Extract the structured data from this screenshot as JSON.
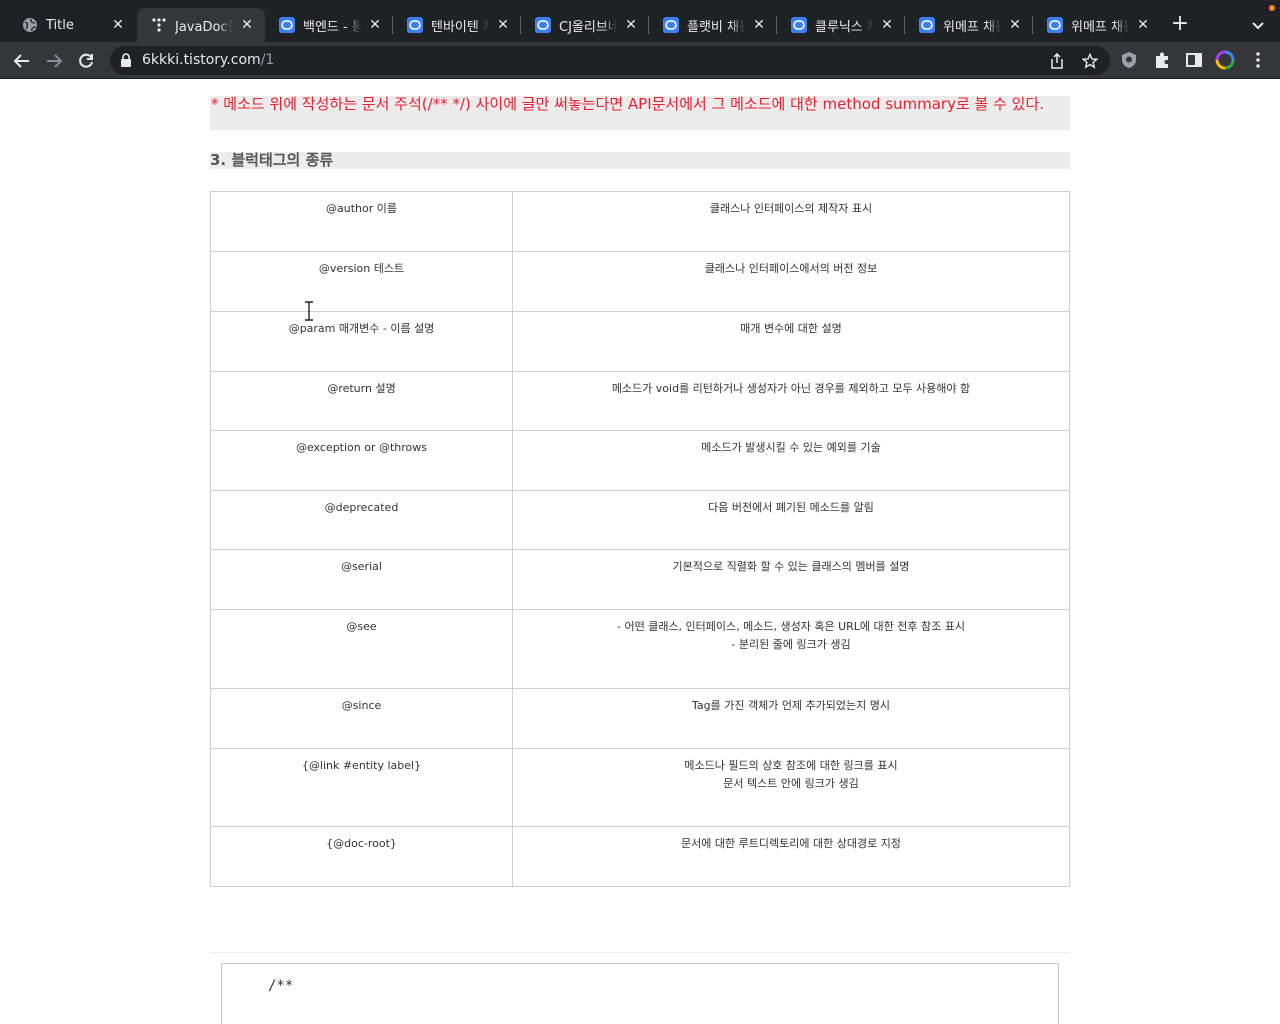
{
  "browser": {
    "tabs": [
      {
        "title": "Title",
        "favicon": "globe-icon",
        "active": false
      },
      {
        "title": "JavaDoc을",
        "favicon": "tistory-icon",
        "active": true
      },
      {
        "title": "백엔드 - 통합",
        "favicon": "chat-app-icon",
        "active": false
      },
      {
        "title": "텐바이텐 채용",
        "favicon": "chat-app-icon",
        "active": false
      },
      {
        "title": "CJ올리브네트",
        "favicon": "chat-app-icon",
        "active": false
      },
      {
        "title": "플랫비 채용 -",
        "favicon": "chat-app-icon",
        "active": false
      },
      {
        "title": "클루닉스 채용",
        "favicon": "chat-app-icon",
        "active": false
      },
      {
        "title": "위메프 채용 -",
        "favicon": "chat-app-icon",
        "active": false
      },
      {
        "title": "위메프 채용 -",
        "favicon": "chat-app-icon",
        "active": false
      }
    ],
    "close_glyph": "✕",
    "new_tab_glyph": "+",
    "url_host": "6kkki.tistory.com",
    "url_path": "/1"
  },
  "article": {
    "note": "* 메소드 위에 작성하는 문서 주석(/** */) 사이에 글만 써놓는다면 API문서에서 그 메소드에 대한 method summary로 볼 수 있다.",
    "heading": "3. 블럭태그의 종류",
    "table": {
      "rows": [
        {
          "tag": "@author 이름",
          "desc": [
            "클래스나 인터페이스의 제작자 표시"
          ]
        },
        {
          "tag": "@version 테스트",
          "desc": [
            "클래스나 인터페이스에서의 버전 정보"
          ]
        },
        {
          "tag": "@param 매개변수 - 이름 설명",
          "desc": [
            "매개 변수에 대한 설명"
          ]
        },
        {
          "tag": "@return 설명",
          "desc": [
            "메소드가 void를 리턴하거나 생성자가 아닌 경우를 제외하고 모두 사용해야 함"
          ]
        },
        {
          "tag": "@exception or @throws",
          "desc": [
            "메소드가 발생시킬 수 있는 예외를 기술"
          ]
        },
        {
          "tag": "@deprecated",
          "desc": [
            "다음 버전에서 폐기된 메소드를 알림"
          ]
        },
        {
          "tag": "@serial",
          "desc": [
            "기본적으로 직렬화 할 수 있는 클래스의 멤버를 설명"
          ]
        },
        {
          "tag": "@see",
          "desc": [
            "- 어떤 클래스, 인터페이스, 메소드, 생성자 혹은 URL에 대한 전후 참조 표시",
            "- 분리된 줄에 링크가 생김"
          ]
        },
        {
          "tag": "@since",
          "desc": [
            "Tag를 가진 객체가 언제 추가되었는지 명시"
          ]
        },
        {
          "tag": "{@link #entity label}",
          "desc": [
            "메소드나 필드의 상호 참조에 대한 링크를 표시",
            "문서 텍스트 안에 링크가 생김"
          ]
        },
        {
          "tag": "{@doc-root}",
          "desc": [
            "문서에 대한 루트디렉토리에 대한 상대경로 지정"
          ]
        }
      ]
    },
    "code_start": "/**"
  },
  "colors": {
    "note_text": "#ee1e2e",
    "highlight_bg": "#ececec",
    "tab_strip": "#202124",
    "toolbar": "#35363a"
  }
}
